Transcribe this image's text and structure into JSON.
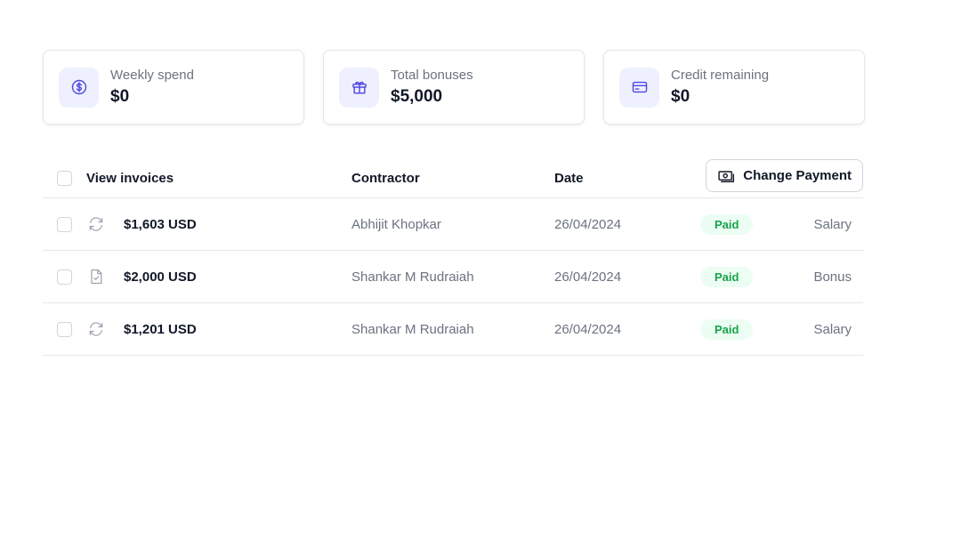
{
  "stats": [
    {
      "label": "Weekly spend",
      "value": "$0",
      "icon": "dollar-circle-icon"
    },
    {
      "label": "Total bonuses",
      "value": "$5,000",
      "icon": "gift-icon"
    },
    {
      "label": "Credit remaining",
      "value": "$0",
      "icon": "credit-card-icon"
    }
  ],
  "table": {
    "headers": {
      "title": "View invoices",
      "contractor": "Contractor",
      "date": "Date"
    },
    "change_payment_label": "Change Payment",
    "rows": [
      {
        "icon": "refresh-icon",
        "amount": "$1,603 USD",
        "contractor": "Abhijit Khopkar",
        "date": "26/04/2024",
        "status": "Paid",
        "type": "Salary"
      },
      {
        "icon": "document-check-icon",
        "amount": "$2,000 USD",
        "contractor": "Shankar M Rudraiah",
        "date": "26/04/2024",
        "status": "Paid",
        "type": "Bonus"
      },
      {
        "icon": "refresh-icon",
        "amount": "$1,201 USD",
        "contractor": "Shankar M Rudraiah",
        "date": "26/04/2024",
        "status": "Paid",
        "type": "Salary"
      }
    ]
  },
  "colors": {
    "accent": "#4f46e5",
    "icon_bg": "#eef0fd",
    "paid_bg": "#ecfdf3",
    "paid_text": "#16a34a"
  }
}
